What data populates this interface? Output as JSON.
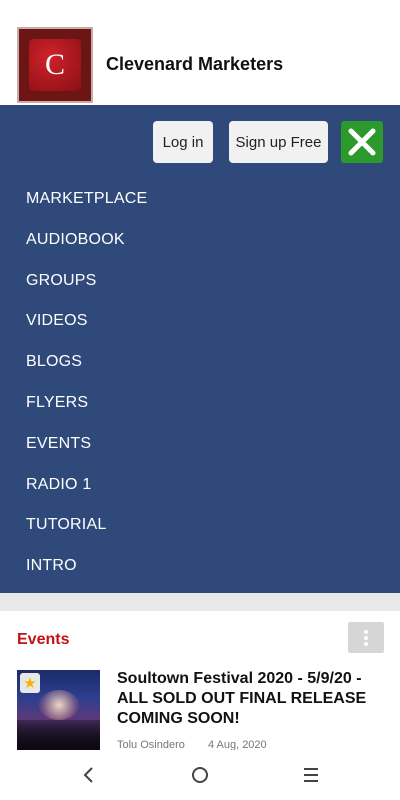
{
  "header": {
    "logo_letter": "C",
    "site_name": "Clevenard Marketers"
  },
  "auth": {
    "login_label": "Log in",
    "signup_label": "Sign up Free"
  },
  "menu": {
    "items": [
      {
        "label": "MARKETPLACE"
      },
      {
        "label": "AUDIOBOOK"
      },
      {
        "label": "GROUPS"
      },
      {
        "label": "VIDEOS"
      },
      {
        "label": "BLOGS"
      },
      {
        "label": "FLYERS"
      },
      {
        "label": "EVENTS"
      },
      {
        "label": "RADIO 1"
      },
      {
        "label": "TUTORIAL"
      },
      {
        "label": "INTRO"
      }
    ]
  },
  "events": {
    "section_title": "Events",
    "items": [
      {
        "title": "Soultown Festival 2020 - 5/9/20 - ALL SOLD OUT FINAL RELEASE COMING SOON!",
        "author": "Tolu Osindero",
        "date": "4 Aug, 2020",
        "featured_icon": "star-icon"
      }
    ]
  },
  "colors": {
    "menu_background": "#2f4a7a",
    "close_button": "#2b9a2a",
    "events_title": "#c41212"
  }
}
